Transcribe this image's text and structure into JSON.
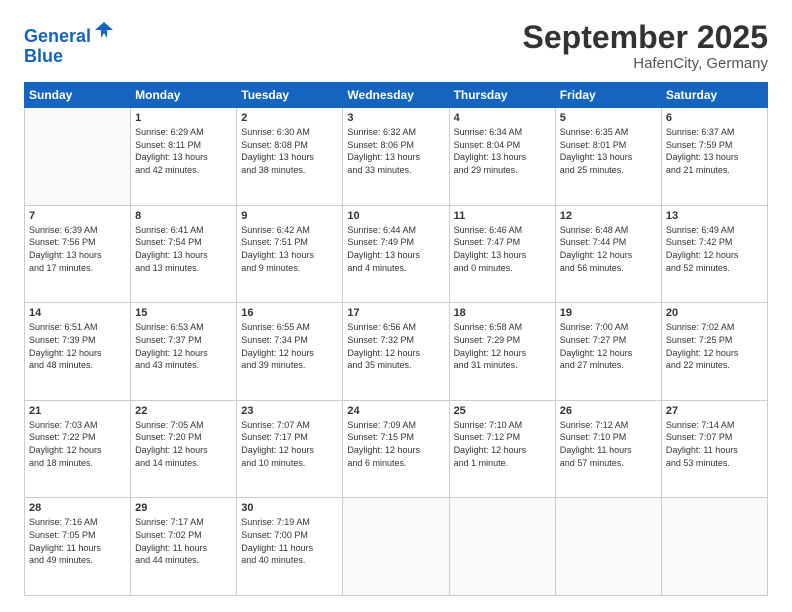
{
  "header": {
    "logo_line1": "General",
    "logo_line2": "Blue",
    "month_title": "September 2025",
    "location": "HafenCity, Germany"
  },
  "days_of_week": [
    "Sunday",
    "Monday",
    "Tuesday",
    "Wednesday",
    "Thursday",
    "Friday",
    "Saturday"
  ],
  "weeks": [
    [
      {
        "day": "",
        "info": ""
      },
      {
        "day": "1",
        "info": "Sunrise: 6:29 AM\nSunset: 8:11 PM\nDaylight: 13 hours\nand 42 minutes."
      },
      {
        "day": "2",
        "info": "Sunrise: 6:30 AM\nSunset: 8:08 PM\nDaylight: 13 hours\nand 38 minutes."
      },
      {
        "day": "3",
        "info": "Sunrise: 6:32 AM\nSunset: 8:06 PM\nDaylight: 13 hours\nand 33 minutes."
      },
      {
        "day": "4",
        "info": "Sunrise: 6:34 AM\nSunset: 8:04 PM\nDaylight: 13 hours\nand 29 minutes."
      },
      {
        "day": "5",
        "info": "Sunrise: 6:35 AM\nSunset: 8:01 PM\nDaylight: 13 hours\nand 25 minutes."
      },
      {
        "day": "6",
        "info": "Sunrise: 6:37 AM\nSunset: 7:59 PM\nDaylight: 13 hours\nand 21 minutes."
      }
    ],
    [
      {
        "day": "7",
        "info": "Sunrise: 6:39 AM\nSunset: 7:56 PM\nDaylight: 13 hours\nand 17 minutes."
      },
      {
        "day": "8",
        "info": "Sunrise: 6:41 AM\nSunset: 7:54 PM\nDaylight: 13 hours\nand 13 minutes."
      },
      {
        "day": "9",
        "info": "Sunrise: 6:42 AM\nSunset: 7:51 PM\nDaylight: 13 hours\nand 9 minutes."
      },
      {
        "day": "10",
        "info": "Sunrise: 6:44 AM\nSunset: 7:49 PM\nDaylight: 13 hours\nand 4 minutes."
      },
      {
        "day": "11",
        "info": "Sunrise: 6:46 AM\nSunset: 7:47 PM\nDaylight: 13 hours\nand 0 minutes."
      },
      {
        "day": "12",
        "info": "Sunrise: 6:48 AM\nSunset: 7:44 PM\nDaylight: 12 hours\nand 56 minutes."
      },
      {
        "day": "13",
        "info": "Sunrise: 6:49 AM\nSunset: 7:42 PM\nDaylight: 12 hours\nand 52 minutes."
      }
    ],
    [
      {
        "day": "14",
        "info": "Sunrise: 6:51 AM\nSunset: 7:39 PM\nDaylight: 12 hours\nand 48 minutes."
      },
      {
        "day": "15",
        "info": "Sunrise: 6:53 AM\nSunset: 7:37 PM\nDaylight: 12 hours\nand 43 minutes."
      },
      {
        "day": "16",
        "info": "Sunrise: 6:55 AM\nSunset: 7:34 PM\nDaylight: 12 hours\nand 39 minutes."
      },
      {
        "day": "17",
        "info": "Sunrise: 6:56 AM\nSunset: 7:32 PM\nDaylight: 12 hours\nand 35 minutes."
      },
      {
        "day": "18",
        "info": "Sunrise: 6:58 AM\nSunset: 7:29 PM\nDaylight: 12 hours\nand 31 minutes."
      },
      {
        "day": "19",
        "info": "Sunrise: 7:00 AM\nSunset: 7:27 PM\nDaylight: 12 hours\nand 27 minutes."
      },
      {
        "day": "20",
        "info": "Sunrise: 7:02 AM\nSunset: 7:25 PM\nDaylight: 12 hours\nand 22 minutes."
      }
    ],
    [
      {
        "day": "21",
        "info": "Sunrise: 7:03 AM\nSunset: 7:22 PM\nDaylight: 12 hours\nand 18 minutes."
      },
      {
        "day": "22",
        "info": "Sunrise: 7:05 AM\nSunset: 7:20 PM\nDaylight: 12 hours\nand 14 minutes."
      },
      {
        "day": "23",
        "info": "Sunrise: 7:07 AM\nSunset: 7:17 PM\nDaylight: 12 hours\nand 10 minutes."
      },
      {
        "day": "24",
        "info": "Sunrise: 7:09 AM\nSunset: 7:15 PM\nDaylight: 12 hours\nand 6 minutes."
      },
      {
        "day": "25",
        "info": "Sunrise: 7:10 AM\nSunset: 7:12 PM\nDaylight: 12 hours\nand 1 minute."
      },
      {
        "day": "26",
        "info": "Sunrise: 7:12 AM\nSunset: 7:10 PM\nDaylight: 11 hours\nand 57 minutes."
      },
      {
        "day": "27",
        "info": "Sunrise: 7:14 AM\nSunset: 7:07 PM\nDaylight: 11 hours\nand 53 minutes."
      }
    ],
    [
      {
        "day": "28",
        "info": "Sunrise: 7:16 AM\nSunset: 7:05 PM\nDaylight: 11 hours\nand 49 minutes."
      },
      {
        "day": "29",
        "info": "Sunrise: 7:17 AM\nSunset: 7:02 PM\nDaylight: 11 hours\nand 44 minutes."
      },
      {
        "day": "30",
        "info": "Sunrise: 7:19 AM\nSunset: 7:00 PM\nDaylight: 11 hours\nand 40 minutes."
      },
      {
        "day": "",
        "info": ""
      },
      {
        "day": "",
        "info": ""
      },
      {
        "day": "",
        "info": ""
      },
      {
        "day": "",
        "info": ""
      }
    ]
  ]
}
